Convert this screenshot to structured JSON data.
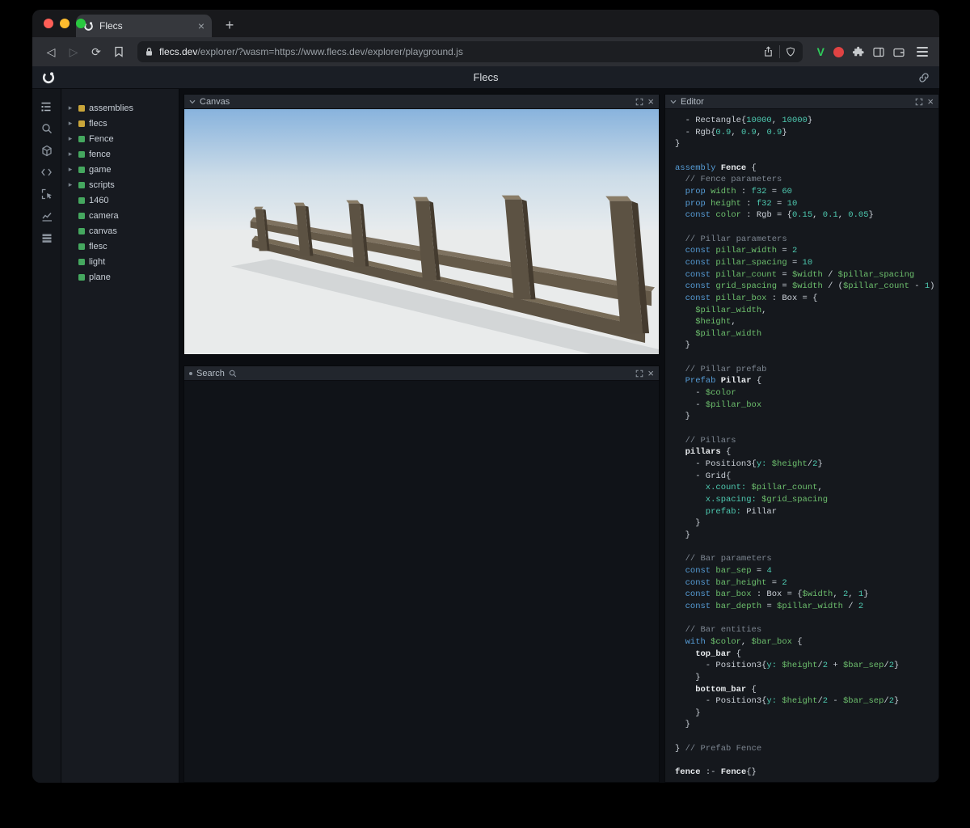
{
  "browser": {
    "tab_title": "Flecs",
    "new_tab_label": "+",
    "url_host": "flecs.dev",
    "url_rest": "/explorer/?wasm=https://www.flecs.dev/explorer/playground.js"
  },
  "app": {
    "title": "Flecs"
  },
  "panels": {
    "canvas": {
      "title": "Canvas"
    },
    "search": {
      "title": "Search"
    },
    "editor": {
      "title": "Editor"
    }
  },
  "rail_icons": [
    "entity-tree",
    "search",
    "scene-cube",
    "code",
    "inspect",
    "stats-chart",
    "tables"
  ],
  "tree": {
    "items": [
      {
        "label": "assemblies",
        "color": "#c9a53a",
        "expandable": true
      },
      {
        "label": "flecs",
        "color": "#c9a53a",
        "expandable": true
      },
      {
        "label": "Fence",
        "color": "#45a85f",
        "expandable": true
      },
      {
        "label": "fence",
        "color": "#45a85f",
        "expandable": true
      },
      {
        "label": "game",
        "color": "#45a85f",
        "expandable": true
      },
      {
        "label": "scripts",
        "color": "#45a85f",
        "expandable": true
      },
      {
        "label": "1460",
        "color": "#45a85f",
        "expandable": false
      },
      {
        "label": "camera",
        "color": "#45a85f",
        "expandable": false
      },
      {
        "label": "canvas",
        "color": "#45a85f",
        "expandable": false
      },
      {
        "label": "flesc",
        "color": "#45a85f",
        "expandable": false
      },
      {
        "label": "light",
        "color": "#45a85f",
        "expandable": false
      },
      {
        "label": "plane",
        "color": "#45a85f",
        "expandable": false
      }
    ]
  },
  "colors": {
    "module_square": "#c9a53a",
    "entity_square": "#45a85f",
    "traffic_red": "#ff5f57",
    "traffic_yellow": "#febc2e",
    "traffic_green": "#29c73f",
    "syntax": {
      "keyword": "#569cd6",
      "identifier": "#6dbf6d",
      "number": "#4ec9b0",
      "comment": "#7d8691",
      "plain": "#ccd2d9",
      "entity": "#e9ecef"
    }
  },
  "editor": {
    "lines": [
      [
        [
          "p",
          "  - Rectangle{"
        ],
        [
          "n",
          "10000"
        ],
        [
          "p",
          ", "
        ],
        [
          "n",
          "10000"
        ],
        [
          "p",
          "}"
        ]
      ],
      [
        [
          "p",
          "  - Rgb{"
        ],
        [
          "n",
          "0.9"
        ],
        [
          "p",
          ", "
        ],
        [
          "n",
          "0.9"
        ],
        [
          "p",
          ", "
        ],
        [
          "n",
          "0.9"
        ],
        [
          "p",
          "}"
        ]
      ],
      [
        [
          "p",
          "}"
        ]
      ],
      [],
      [
        [
          "b",
          "assembly "
        ],
        [
          "e",
          "Fence"
        ],
        [
          "p",
          " {"
        ]
      ],
      [
        [
          "c",
          "  // Fence parameters"
        ]
      ],
      [
        [
          "b",
          "  prop "
        ],
        [
          "g",
          "width"
        ],
        [
          "p",
          " : "
        ],
        [
          "n",
          "f32"
        ],
        [
          "p",
          " = "
        ],
        [
          "n",
          "60"
        ]
      ],
      [
        [
          "b",
          "  prop "
        ],
        [
          "g",
          "height"
        ],
        [
          "p",
          " : "
        ],
        [
          "n",
          "f32"
        ],
        [
          "p",
          " = "
        ],
        [
          "n",
          "10"
        ]
      ],
      [
        [
          "b",
          "  const "
        ],
        [
          "g",
          "color"
        ],
        [
          "p",
          " : Rgb = {"
        ],
        [
          "n",
          "0.15"
        ],
        [
          "p",
          ", "
        ],
        [
          "n",
          "0.1"
        ],
        [
          "p",
          ", "
        ],
        [
          "n",
          "0.05"
        ],
        [
          "p",
          "}"
        ]
      ],
      [],
      [
        [
          "c",
          "  // Pillar parameters"
        ]
      ],
      [
        [
          "b",
          "  const "
        ],
        [
          "g",
          "pillar_width"
        ],
        [
          "p",
          " = "
        ],
        [
          "n",
          "2"
        ]
      ],
      [
        [
          "b",
          "  const "
        ],
        [
          "g",
          "pillar_spacing"
        ],
        [
          "p",
          " = "
        ],
        [
          "n",
          "10"
        ]
      ],
      [
        [
          "b",
          "  const "
        ],
        [
          "g",
          "pillar_count"
        ],
        [
          "p",
          " = "
        ],
        [
          "g",
          "$width"
        ],
        [
          "p",
          " / "
        ],
        [
          "g",
          "$pillar_spacing"
        ]
      ],
      [
        [
          "b",
          "  const "
        ],
        [
          "g",
          "grid_spacing"
        ],
        [
          "p",
          " = "
        ],
        [
          "g",
          "$width"
        ],
        [
          "p",
          " / ("
        ],
        [
          "g",
          "$pillar_count"
        ],
        [
          "p",
          " - "
        ],
        [
          "n",
          "1"
        ],
        [
          "p",
          ")"
        ]
      ],
      [
        [
          "b",
          "  const "
        ],
        [
          "g",
          "pillar_box"
        ],
        [
          "p",
          " : Box = {"
        ]
      ],
      [
        [
          "g",
          "    $pillar_width"
        ],
        [
          "p",
          ","
        ]
      ],
      [
        [
          "g",
          "    $height"
        ],
        [
          "p",
          ","
        ]
      ],
      [
        [
          "g",
          "    $pillar_width"
        ]
      ],
      [
        [
          "p",
          "  }"
        ]
      ],
      [],
      [
        [
          "c",
          "  // Pillar prefab"
        ]
      ],
      [
        [
          "b",
          "  Prefab "
        ],
        [
          "e",
          "Pillar"
        ],
        [
          "p",
          " {"
        ]
      ],
      [
        [
          "p",
          "    - "
        ],
        [
          "g",
          "$color"
        ]
      ],
      [
        [
          "p",
          "    - "
        ],
        [
          "g",
          "$pillar_box"
        ]
      ],
      [
        [
          "p",
          "  }"
        ]
      ],
      [],
      [
        [
          "c",
          "  // Pillars"
        ]
      ],
      [
        [
          "e",
          "  pillars"
        ],
        [
          "p",
          " {"
        ]
      ],
      [
        [
          "p",
          "    - Position3{"
        ],
        [
          "n",
          "y: "
        ],
        [
          "g",
          "$height"
        ],
        [
          "p",
          "/"
        ],
        [
          "n",
          "2"
        ],
        [
          "p",
          "}"
        ]
      ],
      [
        [
          "p",
          "    - Grid{"
        ]
      ],
      [
        [
          "n",
          "      x.count: "
        ],
        [
          "g",
          "$pillar_count"
        ],
        [
          "p",
          ","
        ]
      ],
      [
        [
          "n",
          "      x.spacing: "
        ],
        [
          "g",
          "$grid_spacing"
        ]
      ],
      [
        [
          "n",
          "      prefab: "
        ],
        [
          "p",
          "Pillar"
        ]
      ],
      [
        [
          "p",
          "    }"
        ]
      ],
      [
        [
          "p",
          "  }"
        ]
      ],
      [],
      [
        [
          "c",
          "  // Bar parameters"
        ]
      ],
      [
        [
          "b",
          "  const "
        ],
        [
          "g",
          "bar_sep"
        ],
        [
          "p",
          " = "
        ],
        [
          "n",
          "4"
        ]
      ],
      [
        [
          "b",
          "  const "
        ],
        [
          "g",
          "bar_height"
        ],
        [
          "p",
          " = "
        ],
        [
          "n",
          "2"
        ]
      ],
      [
        [
          "b",
          "  const "
        ],
        [
          "g",
          "bar_box"
        ],
        [
          "p",
          " : Box = {"
        ],
        [
          "g",
          "$width"
        ],
        [
          "p",
          ", "
        ],
        [
          "n",
          "2"
        ],
        [
          "p",
          ", "
        ],
        [
          "n",
          "1"
        ],
        [
          "p",
          "}"
        ]
      ],
      [
        [
          "b",
          "  const "
        ],
        [
          "g",
          "bar_depth"
        ],
        [
          "p",
          " = "
        ],
        [
          "g",
          "$pillar_width"
        ],
        [
          "p",
          " / "
        ],
        [
          "n",
          "2"
        ]
      ],
      [],
      [
        [
          "c",
          "  // Bar entities"
        ]
      ],
      [
        [
          "b",
          "  with "
        ],
        [
          "g",
          "$color"
        ],
        [
          "p",
          ", "
        ],
        [
          "g",
          "$bar_box"
        ],
        [
          "p",
          " {"
        ]
      ],
      [
        [
          "e",
          "    top_bar"
        ],
        [
          "p",
          " {"
        ]
      ],
      [
        [
          "p",
          "      - Position3{"
        ],
        [
          "n",
          "y: "
        ],
        [
          "g",
          "$height"
        ],
        [
          "p",
          "/"
        ],
        [
          "n",
          "2"
        ],
        [
          "p",
          " + "
        ],
        [
          "g",
          "$bar_sep"
        ],
        [
          "p",
          "/"
        ],
        [
          "n",
          "2"
        ],
        [
          "p",
          "}"
        ]
      ],
      [
        [
          "p",
          "    }"
        ]
      ],
      [
        [
          "e",
          "    bottom_bar"
        ],
        [
          "p",
          " {"
        ]
      ],
      [
        [
          "p",
          "      - Position3{"
        ],
        [
          "n",
          "y: "
        ],
        [
          "g",
          "$height"
        ],
        [
          "p",
          "/"
        ],
        [
          "n",
          "2"
        ],
        [
          "p",
          " - "
        ],
        [
          "g",
          "$bar_sep"
        ],
        [
          "p",
          "/"
        ],
        [
          "n",
          "2"
        ],
        [
          "p",
          "}"
        ]
      ],
      [
        [
          "p",
          "    }"
        ]
      ],
      [
        [
          "p",
          "  }"
        ]
      ],
      [],
      [
        [
          "p",
          "} "
        ],
        [
          "c",
          "// Prefab Fence"
        ]
      ],
      [],
      [
        [
          "e",
          "fence"
        ],
        [
          "p",
          " :- "
        ],
        [
          "e",
          "Fence"
        ],
        [
          "p",
          "{}"
        ]
      ]
    ]
  }
}
